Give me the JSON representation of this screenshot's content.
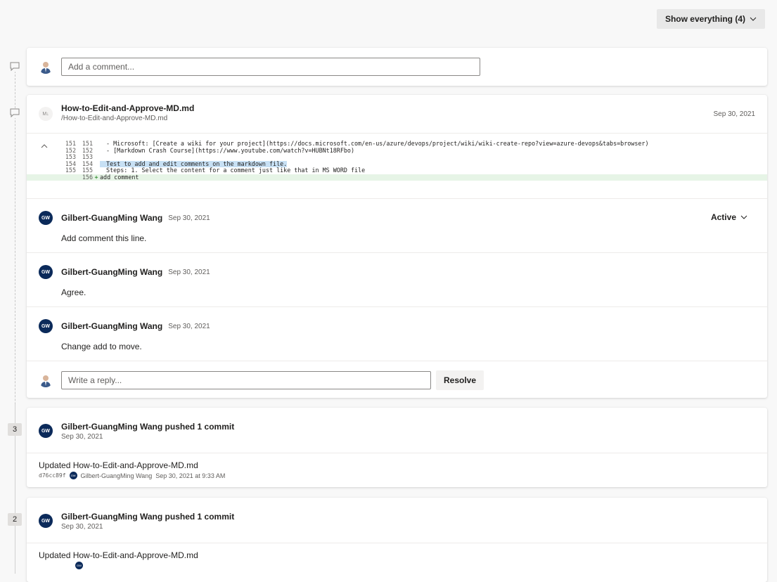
{
  "toolbar": {
    "show_label": "Show everything (4)"
  },
  "add_comment": {
    "placeholder": "Add a comment..."
  },
  "file_thread": {
    "badge": "M↓",
    "file_name": "How-to-Edit-and-Approve-MD.md",
    "file_path": "/How-to-Edit-and-Approve-MD.md",
    "date": "Sep 30, 2021",
    "code_lines": [
      {
        "left": "151",
        "right": "151",
        "marker": "",
        "text": " - Microsoft: [Create a wiki for your project](https://docs.microsoft.com/en-us/azure/devops/project/wiki/wiki-create-repo?view=azure-devops&tabs=browser)"
      },
      {
        "left": "152",
        "right": "152",
        "marker": "",
        "text": " - [Markdown Crash Course](https://www.youtube.com/watch?v=HUBNt18RFbo)"
      },
      {
        "left": "153",
        "right": "153",
        "marker": "",
        "text": ""
      },
      {
        "left": "154",
        "right": "154",
        "marker": "",
        "text": " Test to add and edit comments on the markdown file."
      },
      {
        "left": "155",
        "right": "155",
        "marker": "",
        "text": " Steps: 1. Select the content for a comment just like that in MS WORD file"
      },
      {
        "left": "",
        "right": "156",
        "marker": "+",
        "text": "add comment"
      }
    ],
    "status": "Active",
    "comments": [
      {
        "initials": "GW",
        "author": "Gilbert-GuangMing Wang",
        "date": "Sep 30, 2021",
        "text": "Add comment this line."
      },
      {
        "initials": "GW",
        "author": "Gilbert-GuangMing Wang",
        "date": "Sep 30, 2021",
        "text": "Agree."
      },
      {
        "initials": "GW",
        "author": "Gilbert-GuangMing Wang",
        "date": "Sep 30, 2021",
        "text": "Change add to move."
      }
    ],
    "reply_placeholder": "Write a reply...",
    "resolve_label": "Resolve"
  },
  "pushes": [
    {
      "number": "3",
      "initials": "GW",
      "title": "Gilbert-GuangMing Wang pushed 1 commit",
      "date": "Sep 30, 2021",
      "commit_message": "Updated How-to-Edit-and-Approve-MD.md",
      "commit_hash": "d76cc89f",
      "commit_author": "Gilbert-GuangMing Wang",
      "commit_time": "Sep 30, 2021 at 9:33 AM"
    },
    {
      "number": "2",
      "initials": "GW",
      "title": "Gilbert-GuangMing Wang pushed 1 commit",
      "date": "Sep 30, 2021",
      "commit_message": "Updated How-to-Edit-and-Approve-MD.md"
    }
  ]
}
